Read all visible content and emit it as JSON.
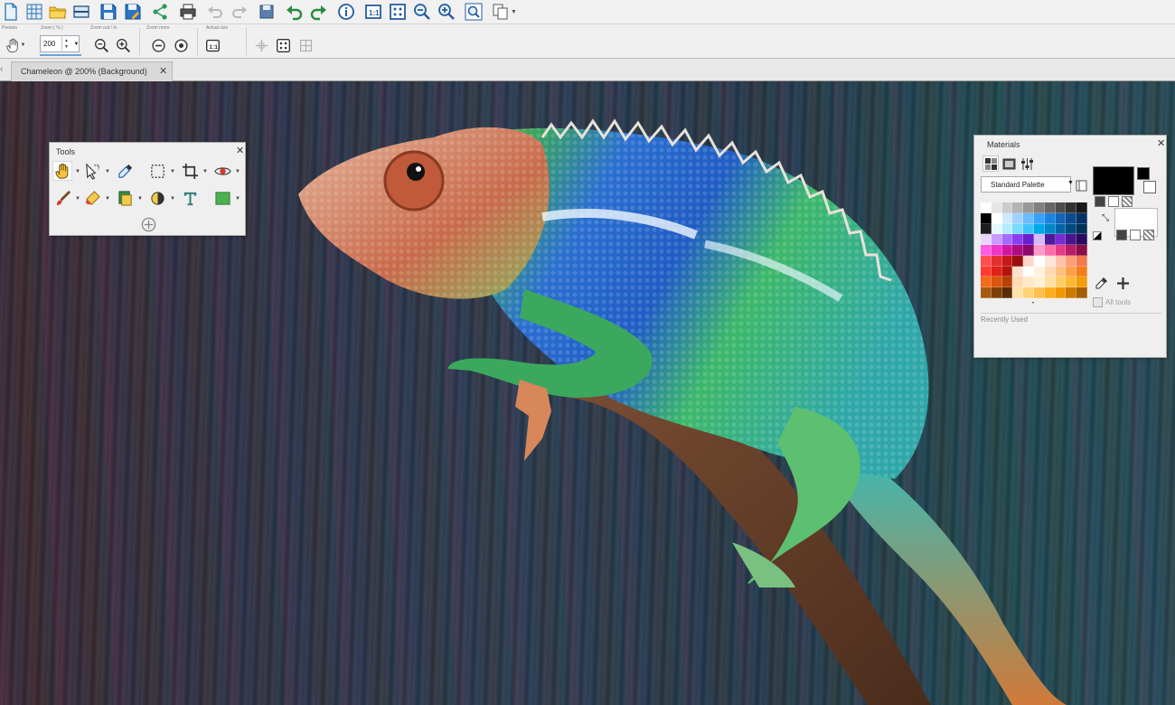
{
  "toolbar": {
    "buttons": [
      {
        "icon": "new-file-icon"
      },
      {
        "icon": "grid-icon"
      },
      {
        "icon": "open-folder-icon"
      },
      {
        "icon": "scan-icon"
      },
      {
        "icon": "save-icon"
      },
      {
        "icon": "save-as-icon"
      },
      {
        "icon": "share-icon"
      },
      {
        "icon": "print-icon"
      },
      {
        "icon": "undo-disabled-icon"
      },
      {
        "icon": "redo-disabled-icon"
      },
      {
        "icon": "revert-icon"
      },
      {
        "icon": "undo-icon"
      },
      {
        "icon": "redo-icon"
      },
      {
        "icon": "info-icon"
      },
      {
        "icon": "actual-size-icon"
      },
      {
        "icon": "fit-window-icon"
      },
      {
        "icon": "zoom-out-icon"
      },
      {
        "icon": "zoom-in-icon"
      },
      {
        "icon": "zoom-rect-icon"
      },
      {
        "icon": "copy-menu-icon"
      }
    ]
  },
  "options": {
    "presets_label": "Presets",
    "zoom_label": "Zoom ( % )",
    "zoom_value": "200",
    "zoom_out_in_label": "Zoom out / In",
    "zoom_more_label": "Zoom more",
    "actual_size_label": "Actual size"
  },
  "document_tab": {
    "title": "Chameleon @ 200% (Background)",
    "close": "✕"
  },
  "tools_panel": {
    "title": "Tools",
    "close": "✕",
    "tools": [
      {
        "icon": "pan-hand-icon",
        "active": true
      },
      {
        "icon": "pick-arrow-icon"
      },
      {
        "icon": "dropper-icon"
      },
      {
        "icon": "selection-icon"
      },
      {
        "icon": "crop-icon"
      },
      {
        "icon": "red-eye-icon"
      },
      {
        "icon": "paint-brush-icon"
      },
      {
        "icon": "eraser-icon"
      },
      {
        "icon": "clone-icon"
      },
      {
        "icon": "dodge-icon"
      },
      {
        "icon": "text-icon"
      },
      {
        "icon": "rectangle-shape-icon"
      }
    ],
    "add_icon": "add-tool-icon"
  },
  "materials_panel": {
    "title": "Materials",
    "close": "✕",
    "palette_name": "Standard Palette",
    "all_tools_label": "All tools",
    "recently_used_label": "Recently Used",
    "foreground_color": "#000000",
    "background_color": "#ffffff",
    "swatches": [
      "#ffffff",
      "#e6e6e6",
      "#cccccc",
      "#b3b3b3",
      "#999999",
      "#808080",
      "#666666",
      "#4d4d4d",
      "#333333",
      "#1a1a1a",
      "#000000",
      "#ffffff",
      "#cfe8ff",
      "#9fd3ff",
      "#6bbcff",
      "#3aa1f7",
      "#1c83e0",
      "#1464b8",
      "#0d4a8f",
      "#073266",
      "#1e1e1e",
      "#e6f7ff",
      "#b3ecff",
      "#7ad9ff",
      "#40c4ff",
      "#00a8e8",
      "#0086c9",
      "#0066a3",
      "#004a7c",
      "#003158",
      "#e9d6ff",
      "#c79bff",
      "#a56bff",
      "#8a3ff0",
      "#6a1fcf",
      "#d7b8ff",
      "#4f1a99",
      "#7a2bd1",
      "#4a148c",
      "#2a0a5e",
      "#ff5ce1",
      "#f035c8",
      "#d1189f",
      "#ad0c84",
      "#8c086b",
      "#ff99c8",
      "#ff6aa8",
      "#e63c86",
      "#b81e62",
      "#8a0f45",
      "#ff4f4f",
      "#e62e2e",
      "#c41a1a",
      "#9a0f0f",
      "#ffd6cc",
      "#ffffff",
      "#ffe5d9",
      "#ffc2a8",
      "#ff9e78",
      "#f27a4f",
      "#ff3b2f",
      "#e02017",
      "#b3130c",
      "#ffe0cc",
      "#ffffff",
      "#fff2e0",
      "#ffd9b3",
      "#ffbf80",
      "#ff9f4a",
      "#f27d1a",
      "#f26a1a",
      "#d9550a",
      "#b34205",
      "#ffd9b3",
      "#ffe9c7",
      "#fff1d6",
      "#ffe0a3",
      "#ffcc66",
      "#ffb833",
      "#f29d0a",
      "#a85a10",
      "#7d3f08",
      "#5a2c05",
      "#ffe3a8",
      "#ffd27a",
      "#ffc04d",
      "#ffad1f",
      "#f29600",
      "#cc7a00",
      "#a35f00"
    ]
  }
}
